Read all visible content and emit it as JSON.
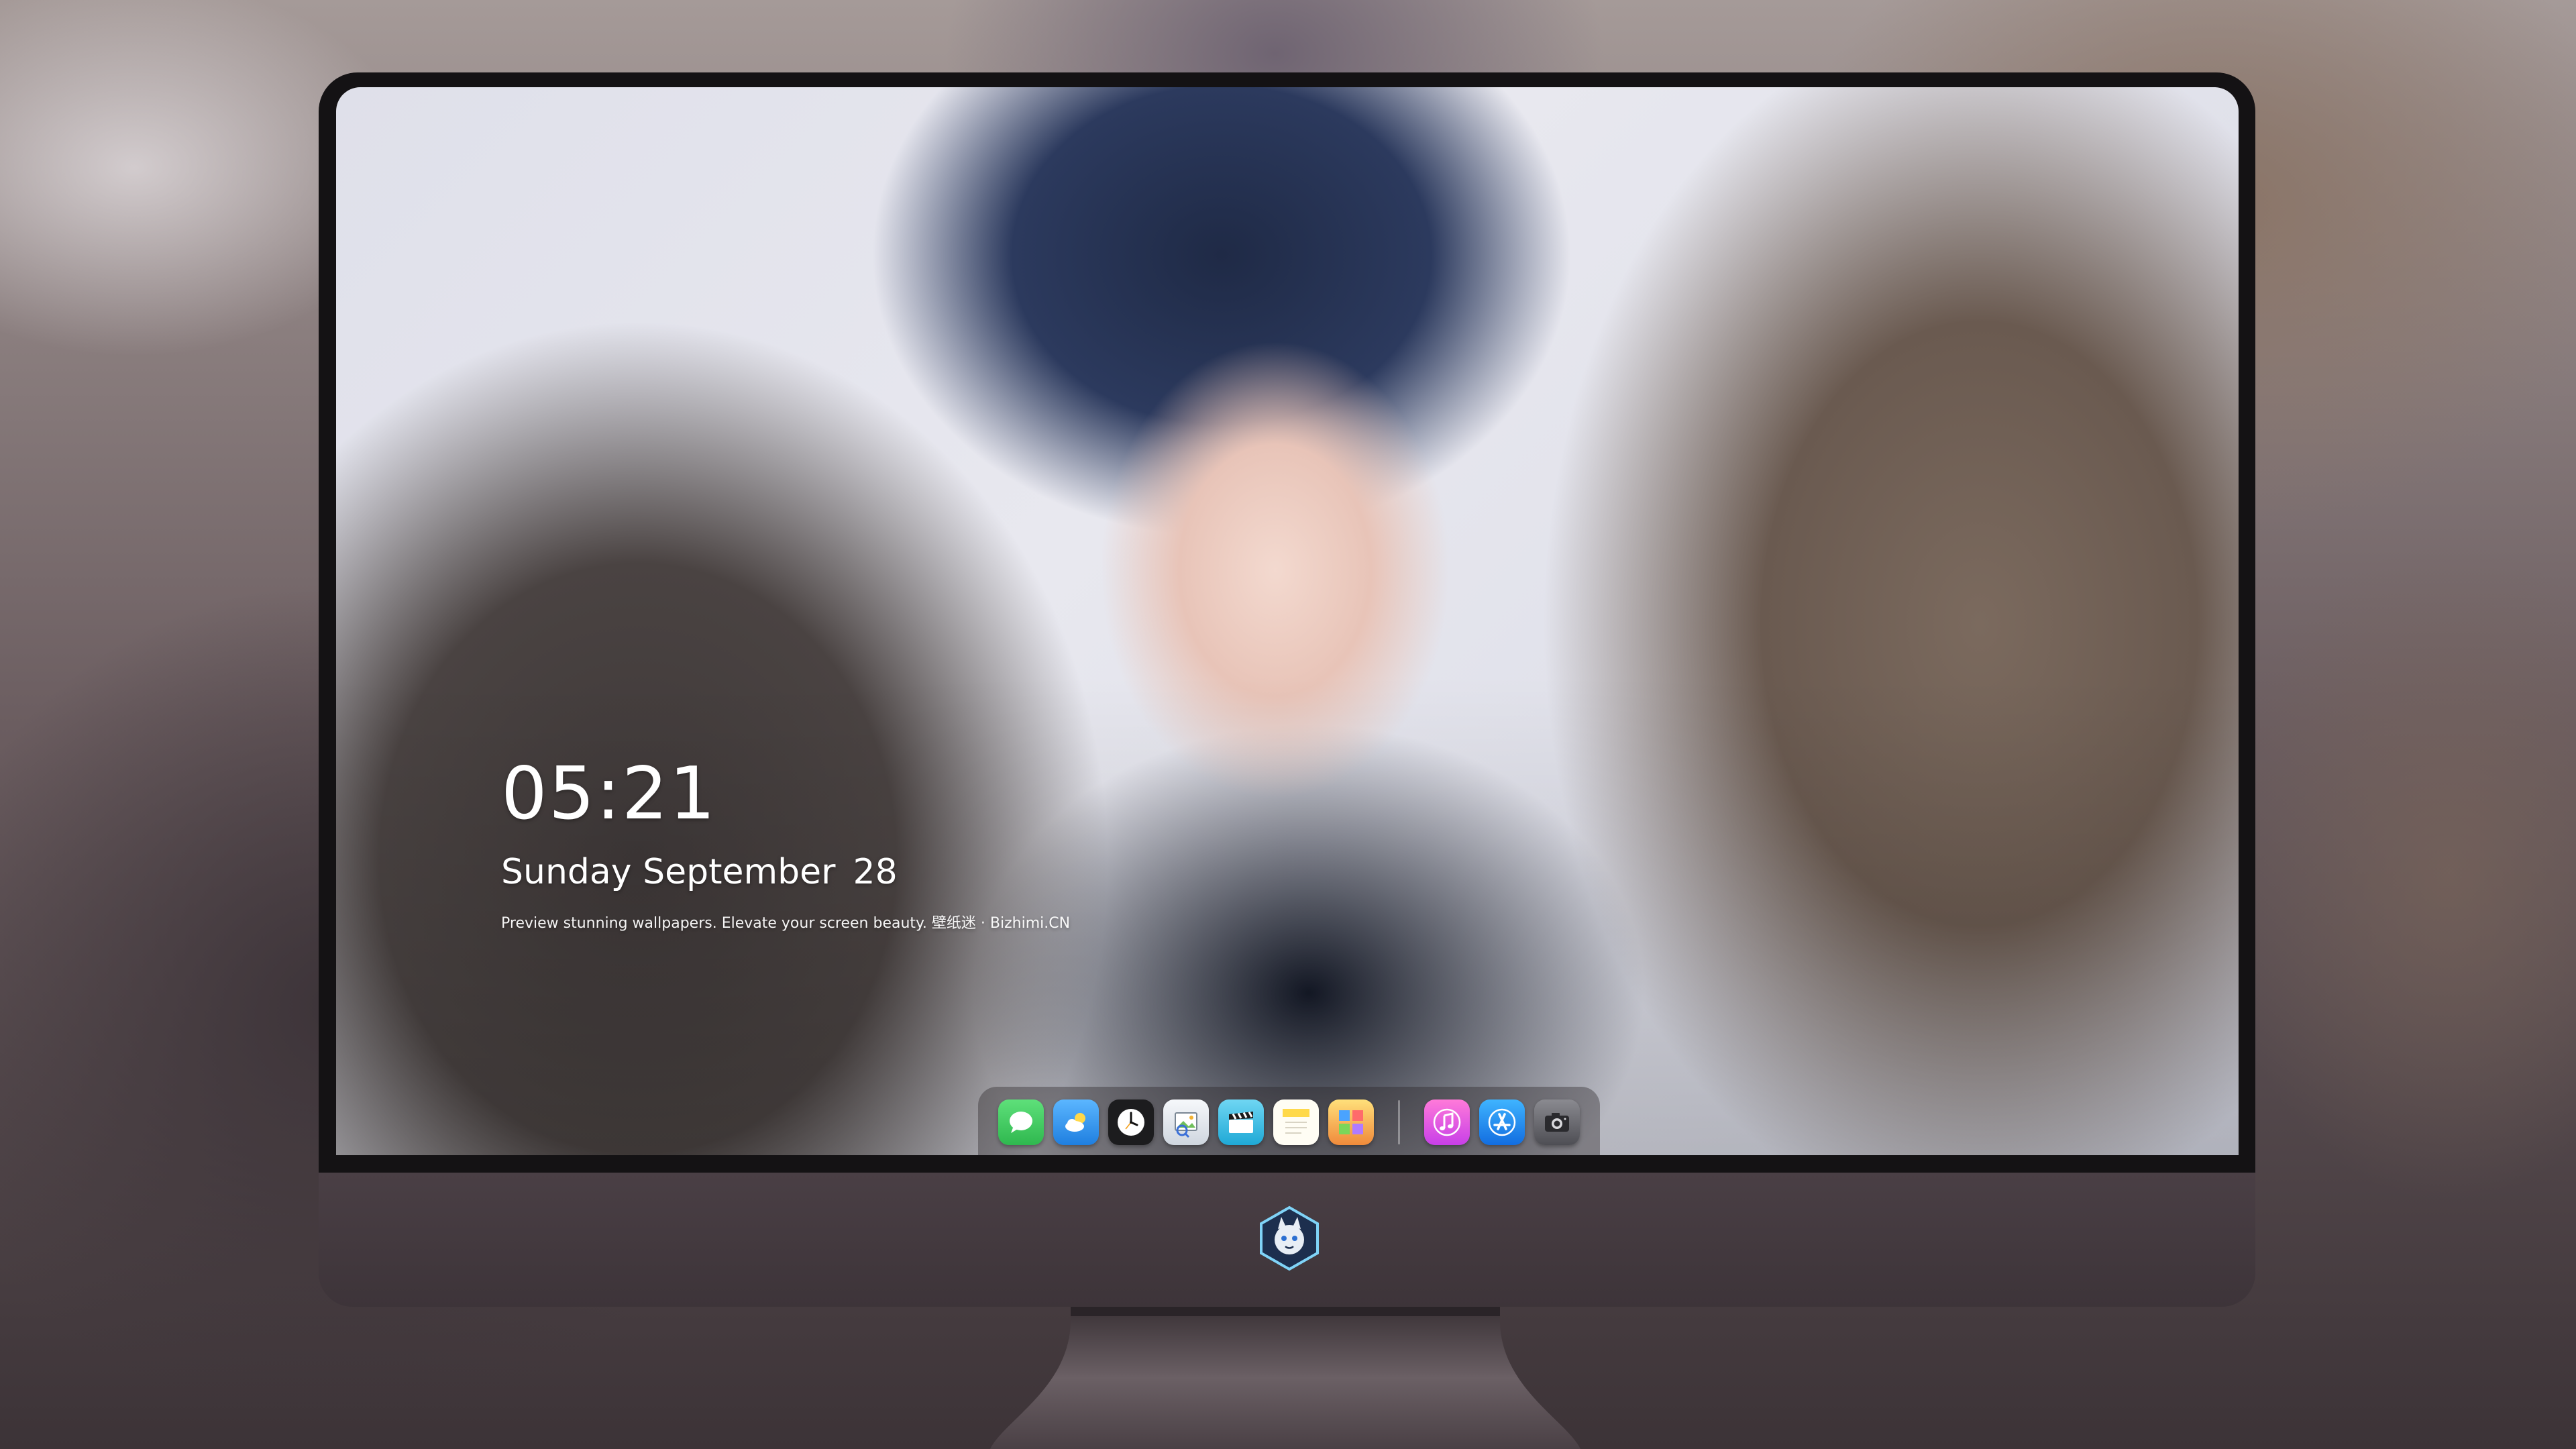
{
  "lock_widget": {
    "time": "05:21",
    "weekday_month": "Sunday September",
    "day": "28",
    "tagline": "Preview stunning wallpapers. Elevate your screen beauty. 壁纸迷 · Bizhimi.CN"
  },
  "dock": {
    "apps": [
      {
        "name": "messages-icon",
        "color": "#34c759"
      },
      {
        "name": "weather-icon",
        "color": "#3b9cf5"
      },
      {
        "name": "clock-icon",
        "color": "#1c1c1e"
      },
      {
        "name": "preview-icon",
        "color": "#e9edf2"
      },
      {
        "name": "claquette-icon",
        "color": "#38c0e6"
      },
      {
        "name": "notes-icon",
        "color": "#ffd94a"
      },
      {
        "name": "photo-booth-icon",
        "color": "#f4a13b"
      },
      {
        "name": "music-icon",
        "color": "#f04fb8"
      },
      {
        "name": "app-store-icon",
        "color": "#1a8ef5"
      },
      {
        "name": "camera-icon",
        "color": "#6d6d72"
      }
    ]
  },
  "colors": {
    "bezel": "#141214",
    "chin": "#3d3439",
    "stand": "#5a4f55"
  }
}
